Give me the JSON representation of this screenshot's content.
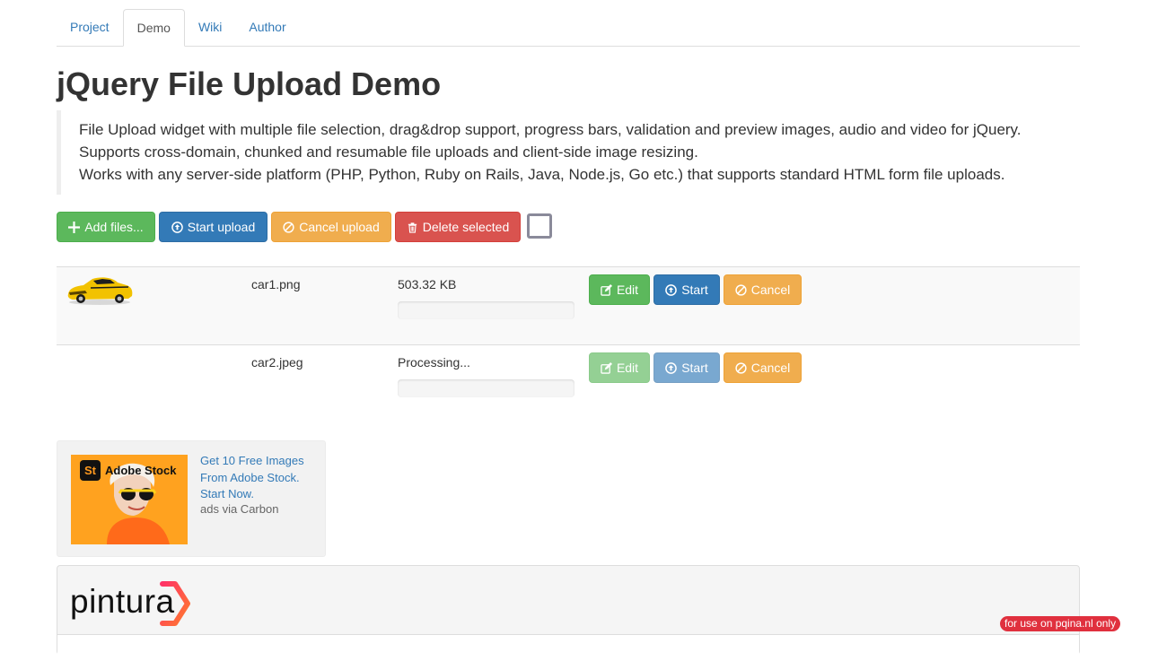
{
  "tabs": [
    {
      "label": "Project"
    },
    {
      "label": "Demo"
    },
    {
      "label": "Wiki"
    },
    {
      "label": "Author"
    }
  ],
  "page_title": "jQuery File Upload Demo",
  "description": [
    "File Upload widget with multiple file selection, drag&drop support, progress bars, validation and preview images, audio and video for jQuery.",
    "Supports cross-domain, chunked and resumable file uploads and client-side image resizing.",
    "Works with any server-side platform (PHP, Python, Ruby on Rails, Java, Node.js, Go etc.) that supports standard HTML form file uploads."
  ],
  "toolbar": {
    "add_files": "Add files...",
    "start_upload": "Start upload",
    "cancel_upload": "Cancel upload",
    "delete_selected": "Delete selected",
    "select_all_checked": false
  },
  "files": [
    {
      "name": "car1.png",
      "status": "503.32 KB",
      "progress": 0,
      "edit_label": "Edit",
      "start_label": "Start",
      "cancel_label": "Cancel",
      "disabled": false
    },
    {
      "name": "car2.jpeg",
      "status": "Processing...",
      "progress": 0,
      "edit_label": "Edit",
      "start_label": "Start",
      "cancel_label": "Cancel",
      "disabled": true
    }
  ],
  "carbon_ad": {
    "brand": "Adobe Stock",
    "brand_mark": "St",
    "text": "Get 10 Free Images From Adobe Stock. Start Now.",
    "via": "ads via Carbon"
  },
  "pintura": {
    "logo_text": "pintura"
  },
  "badge": "for use on pqina.nl only",
  "colors": {
    "success": "#5cb85c",
    "primary": "#337ab7",
    "warning": "#f0ad4e",
    "danger": "#d9534f",
    "link": "#337ab7"
  },
  "icons": {
    "add": "plus-icon",
    "start": "circle-arrow-up-icon",
    "cancel": "ban-circle-icon",
    "delete": "trash-icon",
    "edit": "edit-icon"
  }
}
